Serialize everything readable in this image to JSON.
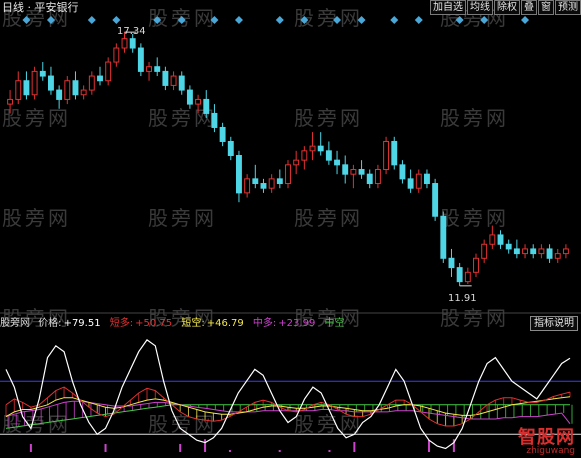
{
  "header": {
    "title": "日线 · 平安银行",
    "toolbar": [
      "加自选",
      "均线",
      "除权",
      "叠",
      "窗",
      "预测"
    ]
  },
  "watermark": "股旁网",
  "main_chart": {
    "high_label": "17.34",
    "low_label": "11.91"
  },
  "indicator_legend": {
    "source": "股旁网",
    "price_label": "价格:",
    "price_value": "+79.51",
    "short_long_label": "短多:",
    "short_long_value": "+50.75",
    "short_short_label": "短空:",
    "short_short_value": "+46.79",
    "mid_long_label": "中多:",
    "mid_long_value": "+23.99",
    "mid_short_label": "中空",
    "button": "指标说明"
  },
  "logo": {
    "text": "智股网",
    "url_text": "zhiguwang"
  },
  "colors": {
    "up": "#e23232",
    "down": "#4fd6e6",
    "diamond": "#4aa8d8",
    "price_line": "#ffffff",
    "short_long": "#e23232",
    "short_short": "#f2e64a",
    "mid_long": "#cc44cc",
    "mid_short": "#44cc44"
  },
  "chart_data": {
    "type": "candlestick",
    "title": "日线 平安银行",
    "ylim": [
      11.5,
      17.6
    ],
    "annotations": [
      {
        "label": "17.34",
        "value": 17.34
      },
      {
        "label": "11.91",
        "value": 11.91
      }
    ],
    "candles": [
      [
        15.8,
        16.1,
        15.6,
        15.9
      ],
      [
        15.9,
        16.5,
        15.8,
        16.3
      ],
      [
        16.3,
        16.5,
        15.9,
        16.0
      ],
      [
        16.0,
        16.6,
        15.9,
        16.5
      ],
      [
        16.5,
        16.7,
        16.3,
        16.4
      ],
      [
        16.4,
        16.6,
        16.0,
        16.1
      ],
      [
        16.1,
        16.2,
        15.7,
        15.9
      ],
      [
        15.9,
        16.4,
        15.8,
        16.3
      ],
      [
        16.3,
        16.5,
        15.9,
        16.0
      ],
      [
        16.0,
        16.2,
        15.9,
        16.1
      ],
      [
        16.1,
        16.5,
        16.0,
        16.4
      ],
      [
        16.4,
        16.6,
        16.2,
        16.3
      ],
      [
        16.3,
        16.8,
        16.2,
        16.7
      ],
      [
        16.7,
        17.1,
        16.6,
        17.0
      ],
      [
        17.0,
        17.34,
        16.9,
        17.2
      ],
      [
        17.2,
        17.3,
        16.9,
        17.0
      ],
      [
        17.0,
        17.1,
        16.4,
        16.5
      ],
      [
        16.5,
        16.7,
        16.3,
        16.6
      ],
      [
        16.6,
        16.8,
        16.4,
        16.5
      ],
      [
        16.5,
        16.6,
        16.1,
        16.2
      ],
      [
        16.2,
        16.5,
        16.1,
        16.4
      ],
      [
        16.4,
        16.5,
        16.0,
        16.1
      ],
      [
        16.1,
        16.2,
        15.7,
        15.8
      ],
      [
        15.8,
        16.0,
        15.6,
        15.9
      ],
      [
        15.9,
        16.1,
        15.5,
        15.6
      ],
      [
        15.6,
        15.8,
        15.2,
        15.3
      ],
      [
        15.3,
        15.4,
        14.9,
        15.0
      ],
      [
        15.0,
        15.1,
        14.6,
        14.7
      ],
      [
        14.7,
        14.8,
        13.7,
        13.9
      ],
      [
        13.9,
        14.3,
        13.8,
        14.2
      ],
      [
        14.2,
        14.5,
        14.0,
        14.1
      ],
      [
        14.1,
        14.2,
        13.9,
        14.0
      ],
      [
        14.0,
        14.3,
        13.9,
        14.2
      ],
      [
        14.2,
        14.4,
        14.0,
        14.1
      ],
      [
        14.1,
        14.6,
        14.0,
        14.5
      ],
      [
        14.5,
        14.8,
        14.3,
        14.6
      ],
      [
        14.6,
        14.9,
        14.4,
        14.8
      ],
      [
        14.8,
        15.2,
        14.6,
        14.9
      ],
      [
        14.9,
        15.2,
        14.7,
        14.8
      ],
      [
        14.8,
        15.0,
        14.5,
        14.6
      ],
      [
        14.6,
        14.8,
        14.3,
        14.5
      ],
      [
        14.5,
        14.7,
        14.1,
        14.3
      ],
      [
        14.3,
        14.5,
        14.0,
        14.4
      ],
      [
        14.4,
        14.6,
        14.2,
        14.3
      ],
      [
        14.3,
        14.4,
        14.0,
        14.1
      ],
      [
        14.1,
        14.5,
        14.0,
        14.4
      ],
      [
        14.4,
        15.1,
        14.3,
        15.0
      ],
      [
        15.0,
        15.1,
        14.4,
        14.5
      ],
      [
        14.5,
        14.6,
        14.1,
        14.2
      ],
      [
        14.2,
        14.4,
        13.9,
        14.0
      ],
      [
        14.0,
        14.4,
        13.9,
        14.3
      ],
      [
        14.3,
        14.4,
        14.0,
        14.1
      ],
      [
        14.1,
        14.2,
        13.3,
        13.4
      ],
      [
        13.4,
        13.5,
        12.4,
        12.5
      ],
      [
        12.5,
        12.7,
        12.1,
        12.3
      ],
      [
        12.3,
        12.4,
        11.91,
        12.0
      ],
      [
        12.0,
        12.3,
        11.95,
        12.2
      ],
      [
        12.2,
        12.6,
        12.1,
        12.5
      ],
      [
        12.5,
        12.9,
        12.4,
        12.8
      ],
      [
        12.8,
        13.2,
        12.7,
        13.0
      ],
      [
        13.0,
        13.1,
        12.7,
        12.8
      ],
      [
        12.8,
        12.9,
        12.6,
        12.7
      ],
      [
        12.7,
        12.9,
        12.5,
        12.6
      ],
      [
        12.6,
        12.8,
        12.5,
        12.7
      ],
      [
        12.7,
        12.8,
        12.5,
        12.6
      ],
      [
        12.6,
        12.8,
        12.5,
        12.7
      ],
      [
        12.7,
        12.8,
        12.4,
        12.5
      ],
      [
        12.5,
        12.7,
        12.4,
        12.6
      ],
      [
        12.6,
        12.8,
        12.5,
        12.7
      ]
    ],
    "indicator": {
      "price": [
        70,
        55,
        30,
        20,
        45,
        80,
        90,
        85,
        60,
        40,
        25,
        15,
        20,
        35,
        55,
        70,
        85,
        95,
        90,
        60,
        35,
        20,
        15,
        10,
        8,
        12,
        20,
        35,
        50,
        60,
        70,
        65,
        50,
        35,
        25,
        30,
        45,
        55,
        50,
        35,
        20,
        12,
        15,
        25,
        30,
        40,
        55,
        70,
        60,
        40,
        20,
        10,
        5,
        3,
        8,
        20,
        40,
        60,
        75,
        80,
        70,
        60,
        55,
        50,
        45,
        55,
        65,
        75,
        79.51
      ],
      "short_long": [
        40,
        45,
        42,
        38,
        40,
        46,
        52,
        55,
        50,
        44,
        38,
        33,
        30,
        32,
        38,
        44,
        50,
        54,
        52,
        46,
        40,
        34,
        30,
        28,
        27,
        26,
        27,
        30,
        34,
        38,
        42,
        44,
        42,
        38,
        35,
        34,
        36,
        40,
        42,
        40,
        36,
        32,
        30,
        30,
        32,
        36,
        40,
        44,
        44,
        40,
        34,
        28,
        24,
        22,
        22,
        24,
        28,
        34,
        40,
        44,
        46,
        46,
        44,
        42,
        42,
        44,
        47,
        49,
        50.75
      ],
      "short_short": [
        30,
        34,
        36,
        36,
        38,
        40,
        44,
        46,
        46,
        44,
        42,
        40,
        38,
        37,
        38,
        40,
        42,
        44,
        45,
        44,
        42,
        40,
        38,
        36,
        34,
        33,
        32,
        32,
        33,
        34,
        36,
        38,
        39,
        39,
        38,
        37,
        37,
        38,
        39,
        39,
        38,
        37,
        36,
        35,
        35,
        36,
        37,
        39,
        40,
        40,
        39,
        37,
        35,
        33,
        32,
        31,
        31,
        32,
        34,
        36,
        38,
        40,
        41,
        42,
        43,
        44,
        45,
        46,
        46.79
      ],
      "mid_long": [
        30,
        32,
        34,
        35,
        36,
        38,
        40,
        42,
        43,
        43,
        42,
        41,
        40,
        39,
        39,
        39,
        40,
        41,
        42,
        42,
        41,
        40,
        39,
        38,
        37,
        36,
        35,
        34,
        34,
        34,
        34,
        35,
        35,
        35,
        35,
        35,
        35,
        35,
        36,
        36,
        35,
        35,
        34,
        34,
        34,
        34,
        34,
        35,
        35,
        35,
        34,
        33,
        32,
        31,
        30,
        29,
        28,
        28,
        28,
        28,
        29,
        29,
        30,
        30,
        30,
        31,
        32,
        33,
        23.99
      ],
      "mid_short": [
        20,
        21,
        22,
        23,
        24,
        25,
        26,
        27,
        28,
        29,
        30,
        31,
        32,
        33,
        34,
        35,
        36,
        37,
        38,
        39,
        40,
        40,
        40,
        40,
        40,
        40,
        40,
        40,
        40,
        40,
        40,
        40,
        40,
        40,
        40,
        40,
        40,
        40,
        40,
        40,
        40,
        40,
        40,
        40,
        40,
        40,
        40,
        40,
        40,
        40,
        40,
        40,
        40,
        40,
        40,
        40,
        40,
        40,
        40,
        40,
        40,
        40,
        40,
        40,
        40,
        40,
        40,
        40,
        40
      ]
    }
  }
}
